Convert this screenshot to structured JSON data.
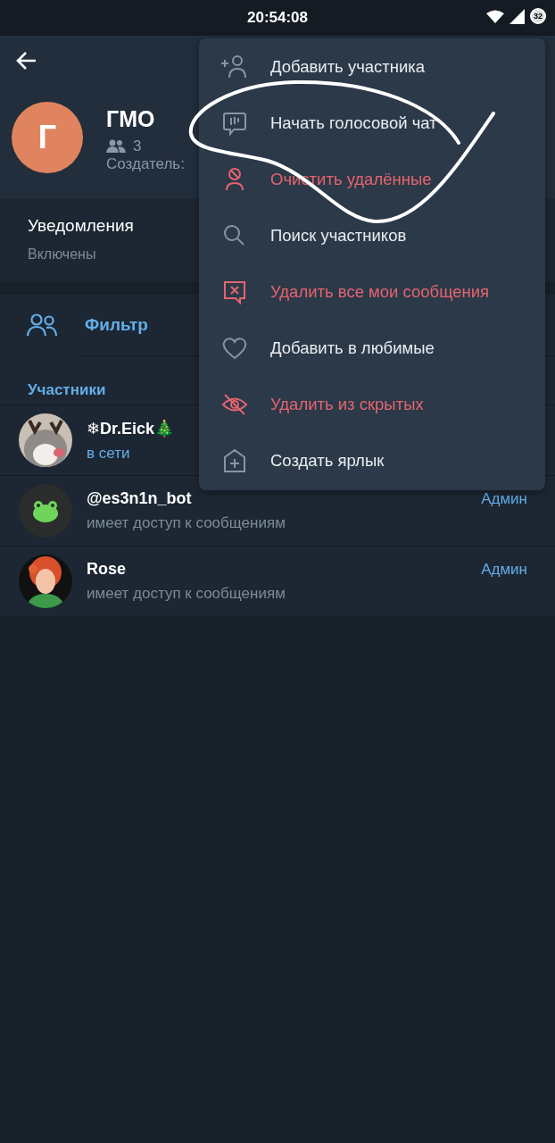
{
  "status_bar": {
    "time": "20:54:08",
    "battery": "32"
  },
  "header": {
    "avatar_letter": "Г",
    "title": "ГМО",
    "members_count": "3",
    "creator_label": "Создатель:"
  },
  "notifications": {
    "label": "Уведомления",
    "value": "Включены"
  },
  "filter": {
    "label": "Фильтр"
  },
  "members_heading": "Участники",
  "members": [
    {
      "name": "❄Dr.Eick🎄",
      "status": "в сети",
      "online": true
    },
    {
      "name": "@es3n1n_bot",
      "status": "имеет доступ к сообщениям",
      "online": false,
      "role": "Админ"
    },
    {
      "name": "Rose",
      "status": "имеет доступ к сообщениям",
      "online": false,
      "role": "Админ"
    }
  ],
  "menu": [
    {
      "label": "Добавить участника",
      "destructive": false
    },
    {
      "label": "Начать голосовой чат",
      "destructive": false
    },
    {
      "label": "Очистить удалённые",
      "destructive": true
    },
    {
      "label": "Поиск участников",
      "destructive": false
    },
    {
      "label": "Удалить все мои сообщения",
      "destructive": true
    },
    {
      "label": "Добавить в любимые",
      "destructive": false
    },
    {
      "label": "Удалить из скрытых",
      "destructive": true
    },
    {
      "label": "Создать ярлык",
      "destructive": false
    }
  ]
}
